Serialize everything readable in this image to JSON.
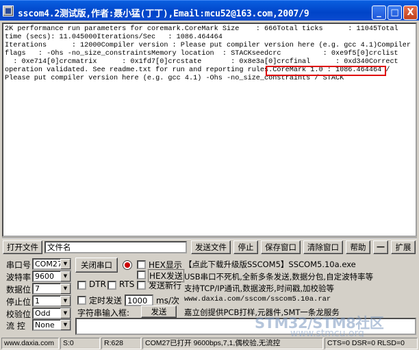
{
  "window": {
    "title": "sscom4.2测试版,作者:聂小猛(丁丁),Email:mcu52@163.com,2007/9",
    "minimize": "_",
    "maximize": "□",
    "close": "X"
  },
  "output": {
    "lines": [
      "2K performance run parameters for coremark.CoreMark Size    : 666Total ticks      : 11045Total",
      "time (secs): 11.045000Iterations/Sec   : 1086.464464",
      "Iterations      : 12000Compiler version : Please put compiler version here (e.g. gcc 4.1)Compiler",
      "flags   : -Ohs -no_size_constraintsMemory location  : STACKseedcrc          : 0xe9f5[0]crclist",
      "  : 0xe714[0]crcmatrix      : 0x1fd7[0]crcstate       : 0x8e3a[0]crcfinal      : 0xd340Correct",
      "operation validated. See readme.txt for run and reporting rules.CoreMark 1.0 : 1086.464464 /",
      "Please put compiler version here (e.g. gcc 4.1) -Ohs -no_size_constraints / STACK"
    ]
  },
  "toolbar": {
    "open_file": "打开文件",
    "filename": "文件名",
    "send_file": "发送文件",
    "stop": "停止",
    "save_window": "保存窗口",
    "clear_window": "清除窗口",
    "help": "帮助",
    "collapse": "一",
    "expand": "扩展"
  },
  "settings": {
    "port_label": "串口号",
    "port_value": "COM27",
    "baud_label": "波特率",
    "baud_value": "9600",
    "databits_label": "数据位",
    "databits_value": "7",
    "stopbits_label": "停止位",
    "stopbits_value": "1",
    "parity_label": "校验位",
    "parity_value": "Odd",
    "flow_label": "流  控",
    "flow_value": "None",
    "close_port": "关闭串口",
    "hex_display": "HEX显示",
    "hex_send": "HEX发送",
    "send_newline": "发送新行",
    "dtr": "DTR",
    "rts": "RTS",
    "timed_send": "定时发送",
    "interval_value": "1000",
    "interval_unit": "ms/次",
    "string_input_label": "字符串输入框:",
    "send": "发送"
  },
  "info": {
    "line1": "【点此下载升级版SSCOM5】SSCOM5.10a.exe",
    "line2": "USB串口不死机,全新多条发送,数据分包,自定波特率等",
    "line3": "支持TCP/IP通讯,数据波形,时间戳,加校验等",
    "line4": "www.daxia.com/sscom/sscom5.10a.rar",
    "line5": "嘉立创提供PCB打样,元器件,SMT一条龙服务"
  },
  "statusbar": {
    "url": "www.daxia.com",
    "s": "S:0",
    "r": "R:628",
    "port_status": "COM27已打开  9600bps,7,1,偶校验,无流控",
    "signals": "CTS=0 DSR=0 RLSD=0"
  },
  "watermark": {
    "line1": "STM32/STM8社区",
    "line2": "www.stmcu.org"
  }
}
